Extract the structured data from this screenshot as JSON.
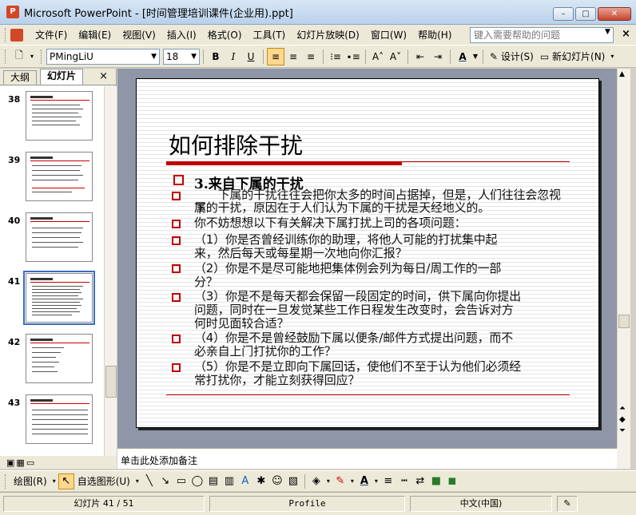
{
  "window": {
    "title": "Microsoft PowerPoint - [时间管理培训课件(企业用).ppt]",
    "minimize": "–",
    "maximize": "□",
    "close": "✕"
  },
  "menu": {
    "items": [
      "文件(F)",
      "编辑(E)",
      "视图(V)",
      "插入(I)",
      "格式(O)",
      "工具(T)",
      "幻灯片放映(D)",
      "窗口(W)",
      "帮助(H)"
    ],
    "help_placeholder": "键入需要帮助的问题",
    "close": "×"
  },
  "toolbar": {
    "font": "PMingLiU",
    "size": "18",
    "bold": "B",
    "italic": "I",
    "underline": "U",
    "design": "设计(S)",
    "new_slide": "新幻灯片(N)"
  },
  "left_pane": {
    "tabs": [
      "大纲",
      "幻灯片"
    ],
    "active_tab": "幻灯片",
    "close": "×",
    "thumbnails": [
      {
        "number": "38"
      },
      {
        "number": "39"
      },
      {
        "number": "40"
      },
      {
        "number": "41",
        "selected": true
      },
      {
        "number": "42"
      },
      {
        "number": "43"
      }
    ]
  },
  "slide": {
    "title": "如何排除干扰",
    "heading": "3.来自下属的干扰",
    "lines": [
      "　　下属的干扰往往会把你太多的时间占据掉，但是，人们往往会忽视下",
      "属的干扰，原因在于人们认为下属的干扰是天经地义的。",
      " 你不妨想想以下有关解决下属打扰上司的各项问题：",
      "（1）你是否曾经训练你的助理，将他人可能的打扰集中起",
      "来，然后每天或每星期一次地向你汇报？",
      "（2）你是不是尽可能地把集体例会列为每日/周工作的一部",
      "分？",
      "（3）你是不是每天都会保留一段固定的时间，供下属向你提出",
      "问题，同时在一旦发觉某些工作日程发生改变时，会告诉对方",
      "何时见面较合适？",
      "（4）你是不是曾经鼓励下属以便条/邮件方式提出问题，而不",
      "必亲自上门打扰你的工作？",
      "（5）你是不是立即向下属回话，使他们不至于认为他们必须经",
      "常打扰你，才能立刻获得回应？"
    ],
    "accent_color": "#c00000"
  },
  "notes": {
    "placeholder": "单击此处添加备注"
  },
  "drawbar": {
    "draw": "绘图(R)",
    "autoshapes": "自选图形(U)"
  },
  "status": {
    "slide_info": "幻灯片 41 / 51",
    "design": "Profile",
    "language": "中文(中国)"
  }
}
